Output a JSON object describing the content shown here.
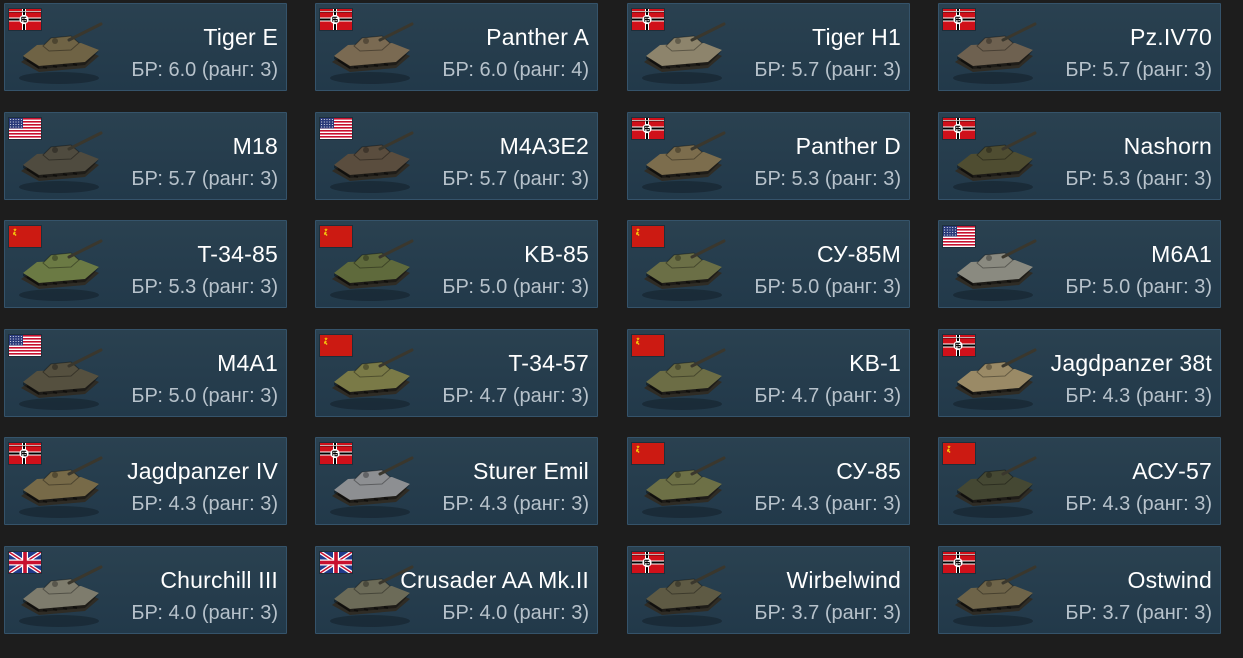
{
  "cards": [
    {
      "name": "Tiger E",
      "br": "БР: 6.0 (ранг: 3)",
      "nation": "germany",
      "tank_color": "#6f6345"
    },
    {
      "name": "Panther A",
      "br": "БР: 6.0 (ранг: 4)",
      "nation": "germany",
      "tank_color": "#7a6a52"
    },
    {
      "name": "Tiger H1",
      "br": "БР: 5.7 (ранг: 3)",
      "nation": "germany",
      "tank_color": "#8d846c"
    },
    {
      "name": "Pz.IV70",
      "br": "БР: 5.7 (ранг: 3)",
      "nation": "germany",
      "tank_color": "#6e6150"
    },
    {
      "name": "M18",
      "br": "БР: 5.7 (ранг: 3)",
      "nation": "usa",
      "tank_color": "#4f4b3f"
    },
    {
      "name": "M4A3E2",
      "br": "БР: 5.7 (ранг: 3)",
      "nation": "usa",
      "tank_color": "#5a4d3e"
    },
    {
      "name": "Panther D",
      "br": "БР: 5.3 (ранг: 3)",
      "nation": "germany",
      "tank_color": "#7c6d4d"
    },
    {
      "name": "Nashorn",
      "br": "БР: 5.3 (ранг: 3)",
      "nation": "germany",
      "tank_color": "#4f4d31"
    },
    {
      "name": "T-34-85",
      "br": "БР: 5.3 (ранг: 3)",
      "nation": "ussr",
      "tank_color": "#6b7a44"
    },
    {
      "name": "KB-85",
      "br": "БР: 5.0 (ранг: 3)",
      "nation": "ussr",
      "tank_color": "#5f6a3c"
    },
    {
      "name": "СУ-85М",
      "br": "БР: 5.0 (ранг: 3)",
      "nation": "ussr",
      "tank_color": "#6b6f46"
    },
    {
      "name": "M6A1",
      "br": "БР: 5.0 (ранг: 3)",
      "nation": "usa",
      "tank_color": "#8a8a80"
    },
    {
      "name": "M4A1",
      "br": "БР: 5.0 (ранг: 3)",
      "nation": "usa",
      "tank_color": "#55503f"
    },
    {
      "name": "T-34-57",
      "br": "БР: 4.7 (ранг: 3)",
      "nation": "ussr",
      "tank_color": "#7a7a47"
    },
    {
      "name": "KB-1",
      "br": "БР: 4.7 (ранг: 3)",
      "nation": "ussr",
      "tank_color": "#6c6d45"
    },
    {
      "name": "Jagdpanzer 38t",
      "br": "БР: 4.3 (ранг: 3)",
      "nation": "germany",
      "tank_color": "#9a8a66"
    },
    {
      "name": "Jagdpanzer IV",
      "br": "БР: 4.3 (ранг: 3)",
      "nation": "germany",
      "tank_color": "#776a48"
    },
    {
      "name": "Sturer Emil",
      "br": "БР: 4.3 (ранг: 3)",
      "nation": "germany",
      "tank_color": "#8d8f92"
    },
    {
      "name": "СУ-85",
      "br": "БР: 4.3 (ранг: 3)",
      "nation": "ussr",
      "tank_color": "#6d7046"
    },
    {
      "name": "АСУ-57",
      "br": "БР: 4.3 (ранг: 3)",
      "nation": "ussr",
      "tank_color": "#454833"
    },
    {
      "name": "Churchill III",
      "br": "БР: 4.0 (ранг: 3)",
      "nation": "uk",
      "tank_color": "#7e7c6d"
    },
    {
      "name": "Crusader AA Mk.II",
      "br": "БР: 4.0 (ранг: 3)",
      "nation": "uk",
      "tank_color": "#6c6b58"
    },
    {
      "name": "Wirbelwind",
      "br": "БР: 3.7 (ранг: 3)",
      "nation": "germany",
      "tank_color": "#5e5a44"
    },
    {
      "name": "Ostwind",
      "br": "БР: 3.7 (ранг: 3)",
      "nation": "germany",
      "tank_color": "#6e6449"
    }
  ]
}
